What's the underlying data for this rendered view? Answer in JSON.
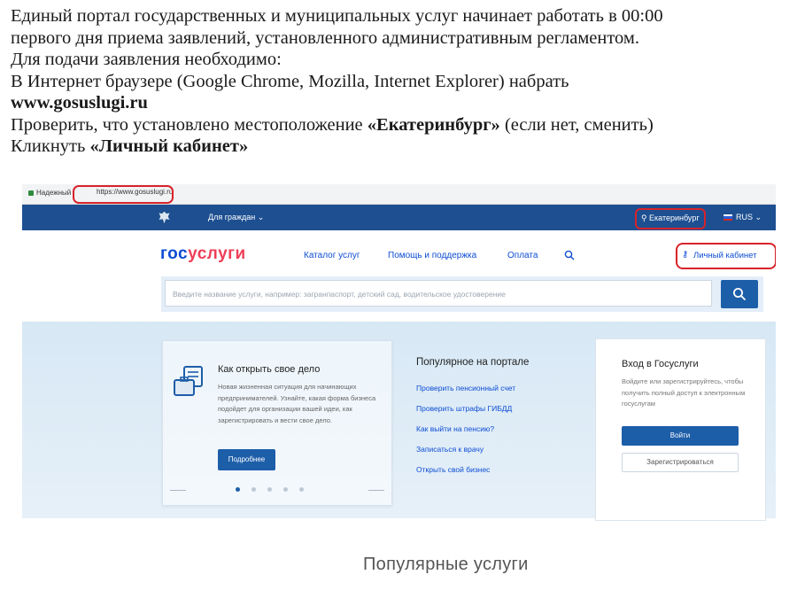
{
  "instructions": {
    "line1": "Единый портал государственных и муниципальных услуг начинает работать в 00:00",
    "line2": "первого дня приема заявлений, установленного административным регламентом.",
    "line3": "Для подачи заявления необходимо:",
    "line4": "В Интернет браузере (Google Chrome, Mozilla, Internet Explorer) набрать",
    "line5": "www.gosuslugi.ru",
    "line6_pre": "Проверить, что установлено местоположение ",
    "line6_bold": "«Екатеринбург»",
    "line6_post": " (если нет, сменить)",
    "line7_pre": "Кликнуть ",
    "line7_bold": "«Личный кабинет»"
  },
  "browser": {
    "secure_label": "Надежный",
    "url": "https://www.gosuslugi.ru"
  },
  "topnav": {
    "for_citizens": "Для граждан ⌄",
    "location": "Екатеринбург",
    "language": "RUS ⌄"
  },
  "header": {
    "logo_part1": "гос",
    "logo_part2": "услуги",
    "menu": [
      "Каталог услуг",
      "Помощь и поддержка",
      "Оплата"
    ],
    "cabinet": "Личный кабинет"
  },
  "search": {
    "placeholder": "Введите название услуги, например: загранпаспорт, детский сад, водительское удостоверение"
  },
  "promo": {
    "title": "Как открыть свое дело",
    "text": "Новая жизненная ситуация для начинающих предпринимателей. Узнайте, какая форма бизнеса подойдет для организации вашей идеи, как зарегистрировать и вести свое дело.",
    "button": "Подробнее"
  },
  "popular": {
    "title": "Популярное на портале",
    "links": [
      "Проверить пенсионный счет",
      "Проверить штрафы ГИБДД",
      "Как выйти на пенсию?",
      "Записаться к врачу",
      "Открыть свой бизнес"
    ]
  },
  "login": {
    "title": "Вход в Госуслуги",
    "text": "Войдите или зарегистрируйтесь, чтобы получить полный доступ к электронным госуслугам",
    "enter_button": "Войти",
    "register_button": "Зарегистрироваться"
  },
  "popular_services_heading": "Популярные услуги",
  "colors": {
    "brand_blue": "#0d4cd3",
    "button_blue": "#1d5ea9",
    "highlight_red": "#d8232a",
    "logo_red": "#ee3f58"
  }
}
